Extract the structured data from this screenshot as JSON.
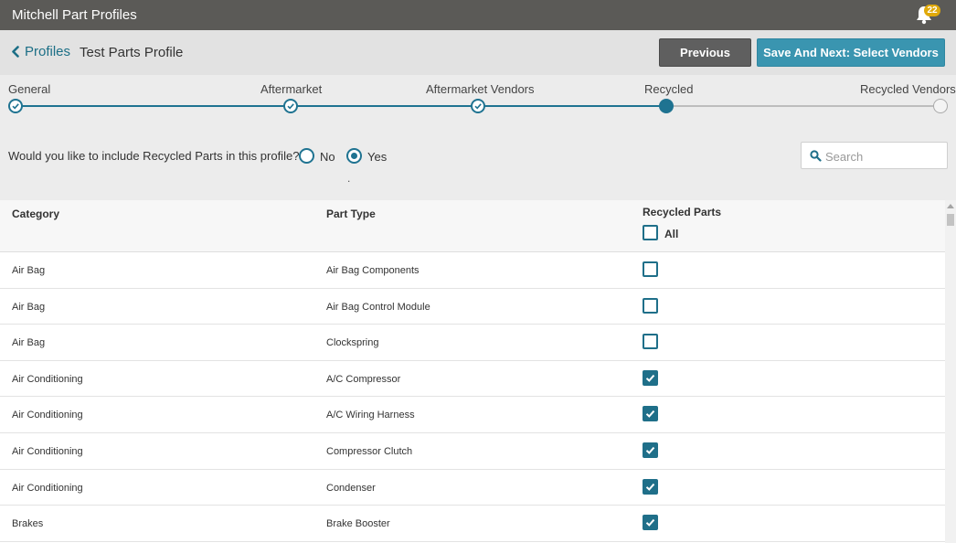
{
  "app": {
    "title": "Mitchell Part Profiles"
  },
  "notifications": {
    "count": "22"
  },
  "header": {
    "back_label": "Profiles",
    "profile_name": "Test Parts Profile",
    "previous_label": "Previous",
    "next_label": "Save And Next: Select Vendors"
  },
  "steps": [
    {
      "label": "General",
      "state": "done"
    },
    {
      "label": "Aftermarket",
      "state": "done"
    },
    {
      "label": "Aftermarket Vendors",
      "state": "done"
    },
    {
      "label": "Recycled",
      "state": "active"
    },
    {
      "label": "Recycled Vendors",
      "state": "todo"
    }
  ],
  "question": {
    "text": "Would you like to include Recycled Parts in this profile?",
    "options": [
      "No",
      "Yes"
    ],
    "selected": "Yes"
  },
  "search": {
    "placeholder": "Search",
    "value": ""
  },
  "table": {
    "headers": {
      "category": "Category",
      "part_type": "Part Type",
      "recycled": "Recycled Parts"
    },
    "all_label": "All",
    "all_checked": false,
    "rows": [
      {
        "category": "Air Bag",
        "part_type": "Air Bag Components",
        "checked": false
      },
      {
        "category": "Air Bag",
        "part_type": "Air Bag Control Module",
        "checked": false
      },
      {
        "category": "Air Bag",
        "part_type": "Clockspring",
        "checked": false
      },
      {
        "category": "Air Conditioning",
        "part_type": "A/C Compressor",
        "checked": true
      },
      {
        "category": "Air Conditioning",
        "part_type": "A/C Wiring Harness",
        "checked": true
      },
      {
        "category": "Air Conditioning",
        "part_type": "Compressor Clutch",
        "checked": true
      },
      {
        "category": "Air Conditioning",
        "part_type": "Condenser",
        "checked": true
      },
      {
        "category": "Brakes",
        "part_type": "Brake Booster",
        "checked": true
      }
    ]
  },
  "colors": {
    "accent": "#1f7391",
    "titlebar": "#5b5a57",
    "primary_button": "#3a95b0",
    "secondary_button": "#5f5f5f",
    "badge": "#e0a90a"
  }
}
